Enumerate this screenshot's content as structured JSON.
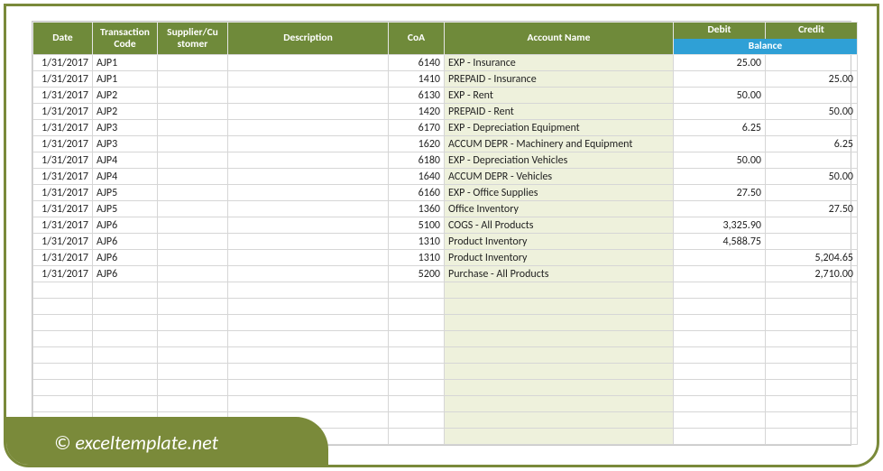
{
  "headers": {
    "date": "Date",
    "transaction_code": "Transaction Code",
    "supplier_customer": "Supplier/Cu stomer",
    "description": "Description",
    "coa": "CoA",
    "account_name": "Account Name",
    "debit": "Debit",
    "credit": "Credit",
    "balance": "Balance"
  },
  "rows": [
    {
      "date": "1/31/2017",
      "code": "AJP1",
      "supplier": "",
      "description": "",
      "coa": "6140",
      "account": "EXP - Insurance",
      "debit": "25.00",
      "credit": ""
    },
    {
      "date": "1/31/2017",
      "code": "AJP1",
      "supplier": "",
      "description": "",
      "coa": "1410",
      "account": "PREPAID - Insurance",
      "debit": "",
      "credit": "25.00"
    },
    {
      "date": "1/31/2017",
      "code": "AJP2",
      "supplier": "",
      "description": "",
      "coa": "6130",
      "account": "EXP - Rent",
      "debit": "50.00",
      "credit": ""
    },
    {
      "date": "1/31/2017",
      "code": "AJP2",
      "supplier": "",
      "description": "",
      "coa": "1420",
      "account": "PREPAID - Rent",
      "debit": "",
      "credit": "50.00"
    },
    {
      "date": "1/31/2017",
      "code": "AJP3",
      "supplier": "",
      "description": "",
      "coa": "6170",
      "account": "EXP - Depreciation Equipment",
      "debit": "6.25",
      "credit": ""
    },
    {
      "date": "1/31/2017",
      "code": "AJP3",
      "supplier": "",
      "description": "",
      "coa": "1620",
      "account": "ACCUM DEPR - Machinery and Equipment",
      "debit": "",
      "credit": "6.25"
    },
    {
      "date": "1/31/2017",
      "code": "AJP4",
      "supplier": "",
      "description": "",
      "coa": "6180",
      "account": "EXP - Depreciation Vehicles",
      "debit": "50.00",
      "credit": ""
    },
    {
      "date": "1/31/2017",
      "code": "AJP4",
      "supplier": "",
      "description": "",
      "coa": "1640",
      "account": "ACCUM DEPR - Vehicles",
      "debit": "",
      "credit": "50.00"
    },
    {
      "date": "1/31/2017",
      "code": "AJP5",
      "supplier": "",
      "description": "",
      "coa": "6160",
      "account": "EXP - Office Supplies",
      "debit": "27.50",
      "credit": ""
    },
    {
      "date": "1/31/2017",
      "code": "AJP5",
      "supplier": "",
      "description": "",
      "coa": "1360",
      "account": "Office Inventory",
      "debit": "",
      "credit": "27.50"
    },
    {
      "date": "1/31/2017",
      "code": "AJP6",
      "supplier": "",
      "description": "",
      "coa": "5100",
      "account": "COGS - All Products",
      "debit": "3,325.90",
      "credit": ""
    },
    {
      "date": "1/31/2017",
      "code": "AJP6",
      "supplier": "",
      "description": "",
      "coa": "1310",
      "account": "Product Inventory",
      "debit": "4,588.75",
      "credit": ""
    },
    {
      "date": "1/31/2017",
      "code": "AJP6",
      "supplier": "",
      "description": "",
      "coa": "1310",
      "account": "Product Inventory",
      "debit": "",
      "credit": "5,204.65"
    },
    {
      "date": "1/31/2017",
      "code": "AJP6",
      "supplier": "",
      "description": "",
      "coa": "5200",
      "account": "Purchase - All Products",
      "debit": "",
      "credit": "2,710.00"
    }
  ],
  "empty_rows": 10,
  "footer": "© exceltemplate.net"
}
